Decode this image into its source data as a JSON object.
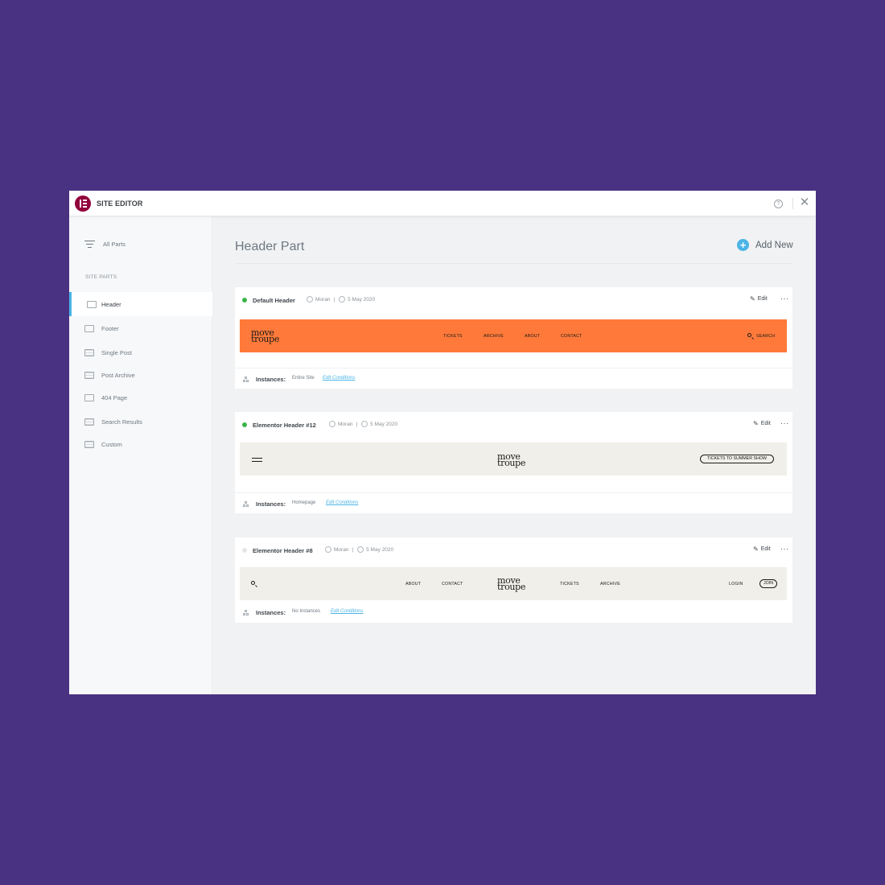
{
  "app": {
    "title": "SITE EDITOR"
  },
  "sidebar": {
    "all_parts": "All Parts",
    "section_label": "SITE PARTS",
    "items": [
      {
        "label": "Header",
        "icon": "header-icon",
        "active": true
      },
      {
        "label": "Footer",
        "icon": "footer-icon"
      },
      {
        "label": "Single Post",
        "icon": "single-post-icon"
      },
      {
        "label": "Post Archive",
        "icon": "post-archive-icon"
      },
      {
        "label": "404 Page",
        "icon": "404-page-icon"
      },
      {
        "label": "Search Results",
        "icon": "search-results-icon"
      },
      {
        "label": "Custom",
        "icon": "custom-icon"
      }
    ]
  },
  "main": {
    "title": "Header Part",
    "add_new": "Add New",
    "instances_label": "Instances:",
    "edit_label": "Edit",
    "edit_conditions": "Edit Conditions",
    "cards": [
      {
        "name": "Default Header",
        "status": "active",
        "author": "Moran",
        "date": "5 May 2020",
        "instances": "Entire Site",
        "preview": {
          "bg": "#ff7a3a",
          "brand_top": "move",
          "brand_bottom": "troupe",
          "nav": [
            "TICKETS",
            "ARCHIVE",
            "ABOUT",
            "CONTACT"
          ],
          "search": "SEARCH"
        }
      },
      {
        "name": "Elementor Header #12",
        "status": "active",
        "author": "Moran",
        "date": "5 May 2020",
        "instances": "Homepage",
        "preview": {
          "bg": "#f1efe9",
          "brand_top": "move",
          "brand_bottom": "troupe",
          "cta": "TICKETS TO SUMMER SHOW"
        }
      },
      {
        "name": "Elementor Header #8",
        "status": "inactive",
        "author": "Moran",
        "date": "5 May 2020",
        "instances": "No Instances",
        "preview": {
          "bg": "#f1efe9",
          "brand_top": "move",
          "brand_bottom": "troupe",
          "nav_left": [
            "ABOUT",
            "CONTACT"
          ],
          "nav_right": [
            "TICKETS",
            "ARCHIVE"
          ],
          "login": "LOGIN",
          "join": "JOIN"
        }
      }
    ]
  },
  "colors": {
    "background": "#4a3282",
    "accent": "#4bb4e6",
    "brand": "#92003b",
    "active_dot": "#39b54a"
  }
}
